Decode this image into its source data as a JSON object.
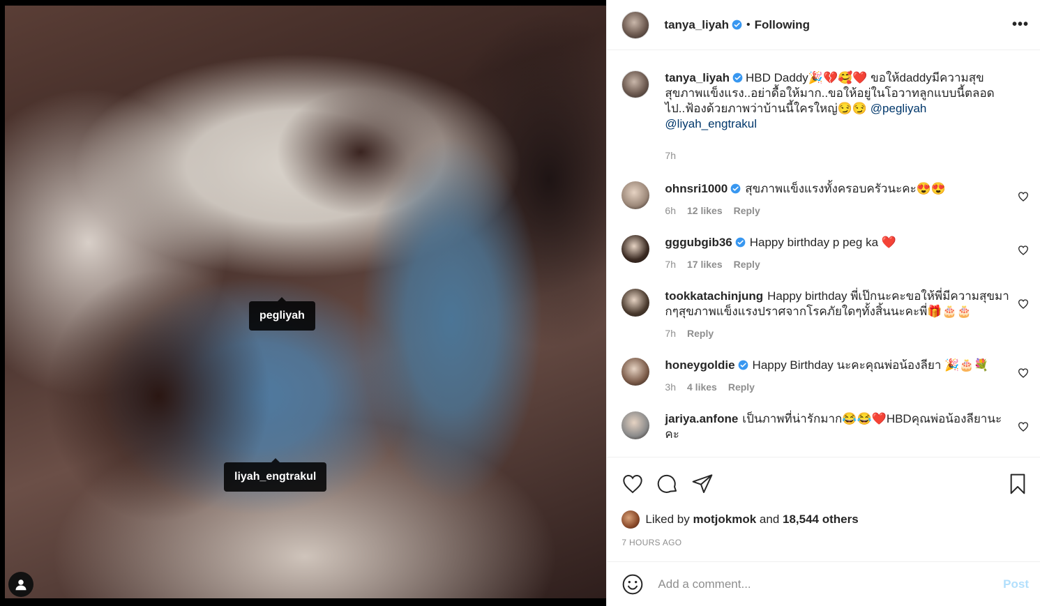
{
  "header": {
    "username": "tanya_liyah",
    "separator": "•",
    "following": "Following",
    "more": "•••"
  },
  "media": {
    "tags": [
      "pegliyah",
      "liyah_engtrakul"
    ]
  },
  "caption": {
    "username": "tanya_liyah",
    "text": "HBD Daddy🎉💔🥰❤️ ขอให้daddyมีความสุขสุขภาพแข็งแรง..อย่าดื้อให้มาก..ขอให้อยู่ในโอวาทลูกแบบนี้ตลอดไป..ฟ้องด้วยภาพว่าบ้านนี้ใครใหญ่😏😏",
    "mention1": "@pegliyah",
    "mention2": "@liyah_engtrakul",
    "time": "7h"
  },
  "comments": [
    {
      "username": "ohnsri1000",
      "verified": true,
      "text": "สุขภาพแข็งแรงทั้งครอบครัวนะคะ😍😍",
      "time": "6h",
      "likes": "12 likes",
      "reply": "Reply",
      "avatar_color": "#9b8778"
    },
    {
      "username": "gggubgib36",
      "verified": true,
      "text": "Happy birthday p peg ka ❤️",
      "time": "7h",
      "likes": "17 likes",
      "reply": "Reply",
      "avatar_color": "#3a2a22"
    },
    {
      "username": "tookkatachinjung",
      "verified": false,
      "text": "Happy birthday พี่เป๊กนะคะขอให้พี่มีความสุขมากๆสุขภาพแข็งแรงปราศจากโรคภัยใดๆทั้งสิ้นนะคะพี่🎁🎂🎂",
      "time": "7h",
      "likes": "",
      "reply": "Reply",
      "avatar_color": "#4a3a2e"
    },
    {
      "username": "honeygoldie",
      "verified": true,
      "text": "Happy Birthday นะคะคุณพ่อน้องลียา 🎉🎂💐",
      "time": "3h",
      "likes": "4 likes",
      "reply": "Reply",
      "avatar_color": "#7a5a48"
    },
    {
      "username": "jariya.anfone",
      "verified": false,
      "text": "เป็นภาพที่น่ารักมาก😂😂❤️HBDคุณพ่อน้องลียานะคะ",
      "time": "",
      "likes": "",
      "reply": "",
      "avatar_color": "#8a8a8a"
    }
  ],
  "likes": {
    "prefix": "Liked by",
    "user": "motjokmok",
    "and": "and",
    "others": "18,544 others"
  },
  "timestamp": "7 HOURS AGO",
  "add_comment": {
    "placeholder": "Add a comment...",
    "post": "Post"
  },
  "colors": {
    "verified": "#3897f0",
    "mention": "#00376b",
    "post_disabled": "#b2dffc",
    "muted": "#8e8e8e"
  }
}
